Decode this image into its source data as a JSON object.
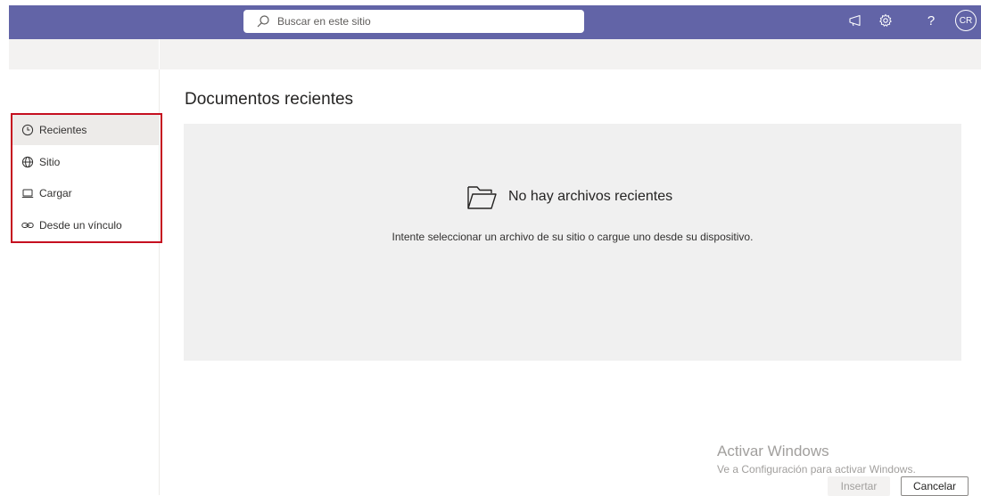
{
  "search": {
    "placeholder": "Buscar en este sitio"
  },
  "header": {
    "icons": [
      "megaphone-icon",
      "settings-icon",
      "help-icon"
    ],
    "help_glyph": "?",
    "avatar_initials": "CR",
    "brand_color": "#6264a7"
  },
  "sidebar": {
    "items": [
      {
        "label": "Recientes",
        "icon": "clock-icon",
        "active": true
      },
      {
        "label": "Sitio",
        "icon": "globe-icon",
        "active": false
      },
      {
        "label": "Cargar",
        "icon": "laptop-icon",
        "active": false
      },
      {
        "label": "Desde un vínculo",
        "icon": "link-icon",
        "active": false
      }
    ],
    "highlight_color": "#c50f1f"
  },
  "main": {
    "title": "Documentos recientes",
    "empty_title": "No hay archivos recientes",
    "empty_description": "Intente seleccionar un archivo de su sitio o cargue uno desde su dispositivo."
  },
  "watermark": {
    "title": "Activar Windows",
    "subtitle": "Ve a Configuración para activar Windows."
  },
  "footer": {
    "insert_label": "Insertar",
    "insert_enabled": false,
    "cancel_label": "Cancelar"
  }
}
